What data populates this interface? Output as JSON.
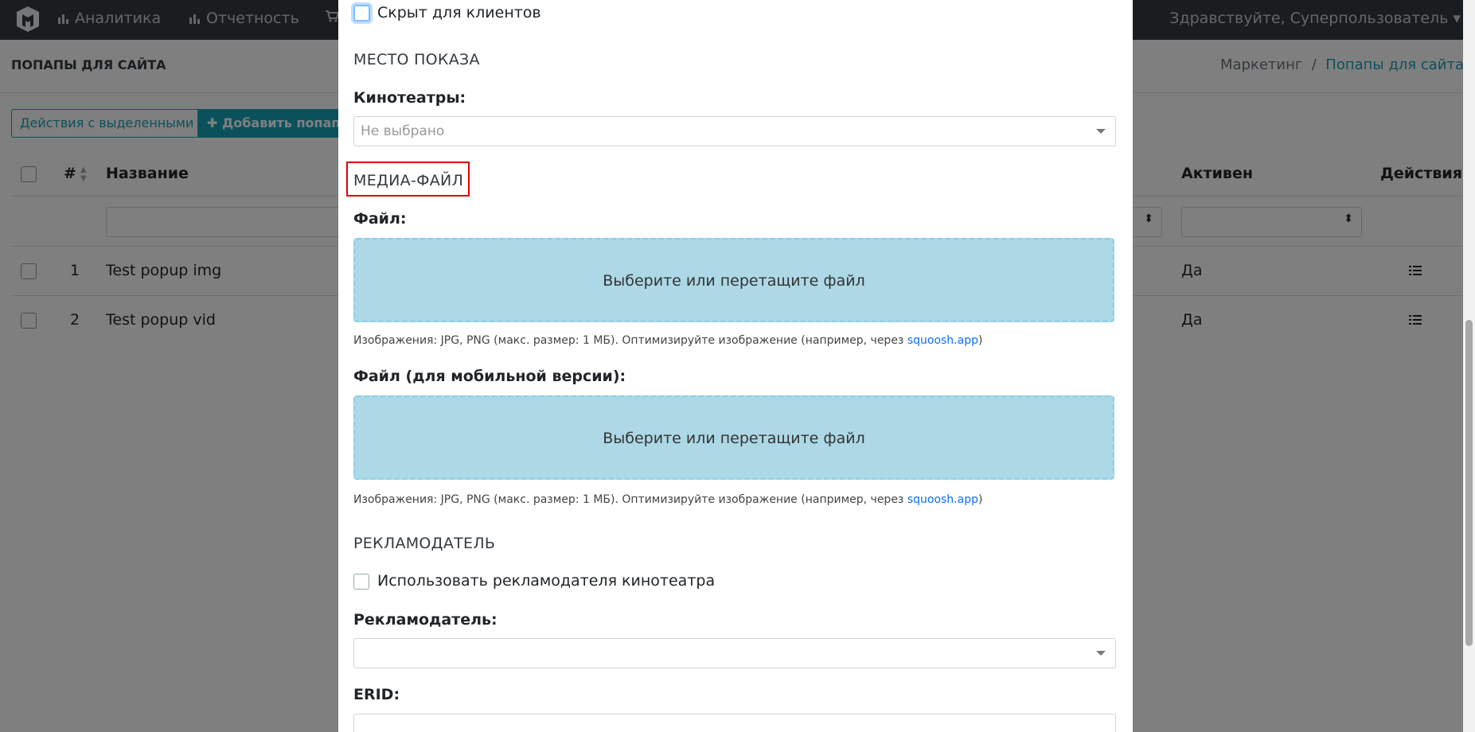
{
  "nav": {
    "items": [
      {
        "label": "Аналитика",
        "icon": "bar-chart-icon"
      },
      {
        "label": "Отчетность",
        "icon": "bar-chart-icon"
      }
    ],
    "greeting": "Здравствуйте, Суперпользователь"
  },
  "page": {
    "title": "ПОПАПЫ ДЛЯ САЙТА",
    "breadcrumb": {
      "parent": "Маркетинг",
      "separator": "/",
      "current": "Попапы для сайта"
    }
  },
  "toolbar": {
    "bulk_actions_label": "Действия с выделенными",
    "add_popup_label": "Добавить попап"
  },
  "table": {
    "columns": [
      "#",
      "Название",
      "Активен",
      "Действия"
    ],
    "rows": [
      {
        "num": "1",
        "name": "Test popup img",
        "active": "Да"
      },
      {
        "num": "2",
        "name": "Test popup vid",
        "active": "Да"
      }
    ]
  },
  "modal": {
    "hidden_for_clients_label": "Скрыт для клиентов",
    "placement_section": "МЕСТО ПОКАЗА",
    "cinemas_label": "Кинотеатры:",
    "cinemas_placeholder": "Не выбрано",
    "media_section": "МЕДИА-ФАЙЛ",
    "file_label": "Файл:",
    "dropzone_text": "Выберите или перетащите файл",
    "file_hint_prefix": "Изображения: JPG, PNG (макс. размер: 1 МБ). Оптимизируйте изображение (например, через ",
    "file_hint_link": "squoosh.app",
    "file_hint_suffix": ")",
    "mobile_file_label": "Файл (для мобильной версии):",
    "mobile_dropzone_text": "Выберите или перетащите файл",
    "advertiser_section": "РЕКЛАМОДАТЕЛЬ",
    "use_cinema_advertiser_label": "Использовать рекламодателя кинотеатра",
    "advertiser_label": "Рекламодатель:",
    "erid_label": "ERID:"
  },
  "colors": {
    "accent": "#17a2b8",
    "dropzone": "#add8e6",
    "highlight": "#e00000",
    "navbar": "#343a40"
  }
}
